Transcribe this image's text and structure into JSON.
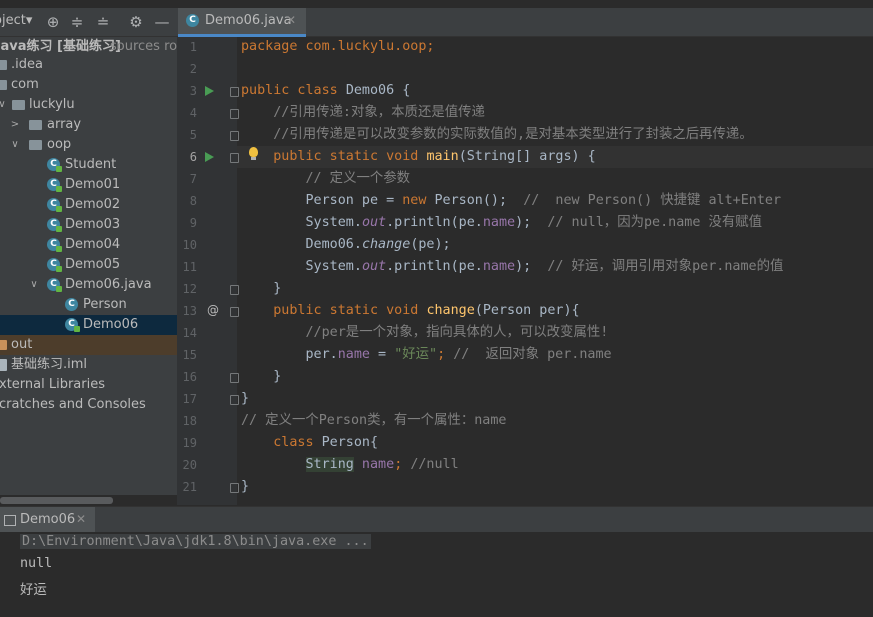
{
  "project_panel": {
    "title": "oject",
    "tree": [
      {
        "label": "java练习 [基础练习]",
        "secondary": "sources roc"
      },
      {
        "label": ".idea"
      },
      {
        "label": "com"
      },
      {
        "label": "luckylu"
      },
      {
        "label": "array"
      },
      {
        "label": "oop"
      },
      {
        "label": "Student"
      },
      {
        "label": "Demo01"
      },
      {
        "label": "Demo02"
      },
      {
        "label": "Demo03"
      },
      {
        "label": "Demo04"
      },
      {
        "label": "Demo05"
      },
      {
        "label": "Demo06.java"
      },
      {
        "label": "Person"
      },
      {
        "label": "Demo06"
      },
      {
        "label": "out"
      },
      {
        "label": "基础练习.iml"
      },
      {
        "label": "xternal Libraries"
      },
      {
        "label": "cratches and Consoles"
      }
    ]
  },
  "editor": {
    "tab": {
      "label": "Demo06.java",
      "close": "✕"
    },
    "line_numbers": [
      "1",
      "2",
      "3",
      "4",
      "5",
      "6",
      "7",
      "8",
      "9",
      "10",
      "11",
      "12",
      "13",
      "14",
      "15",
      "16",
      "17",
      "18",
      "19",
      "20",
      "21"
    ],
    "code": {
      "l1": "package com.luckylu.oop;",
      "l3_kw": "public class ",
      "l3_name": "Demo06 {",
      "l4": "    //引用传递:对象，本质还是值传递",
      "l5": "    //引用传递是可以改变参数的实际数值的,是对基本类型进行了封装之后再传递。",
      "l6_kw": "    public static void ",
      "l6_fn": "main",
      "l6_rest": "(String[] args) {",
      "l7": "        // 定义一个参数",
      "l8_a": "        Person pe = ",
      "l8_kw": "new ",
      "l8_b": "Person();  ",
      "l8_c": "//  new Person() 快捷键 alt+Enter",
      "l9_a": "        System.",
      "l9_out": "out",
      "l9_b": ".println(pe.",
      "l9_name": "name",
      "l9_c": ");  ",
      "l9_cm": "// null，因为pe.name 没有赋值",
      "l10_a": "        Demo06.",
      "l10_m": "change",
      "l10_b": "(pe);",
      "l11_a": "        System.",
      "l11_out": "out",
      "l11_b": ".println(pe.",
      "l11_name": "name",
      "l11_c": ");  ",
      "l11_cm": "// 好运，调用引用对象per.name的值",
      "l12": "    }",
      "l13_kw": "    public static void ",
      "l13_fn": "change",
      "l13_rest": "(Person per){",
      "l14": "        //per是一个对象，指向具体的人，可以改变属性!",
      "l15_a": "        per.",
      "l15_name": "name",
      "l15_b": " = ",
      "l15_str": "\"好运\"",
      "l15_c": "; ",
      "l15_cm": "//  返回对象 per.name",
      "l16": "    }",
      "l17": "}",
      "l18": "// 定义一个Person类，有一个属性：name",
      "l19_kw": "    class ",
      "l19_rest": "Person{",
      "l20_type": "String",
      "l20_name": " name",
      "l20_c": "; ",
      "l20_cm": "//null",
      "l21": "}"
    }
  },
  "run_panel": {
    "tab": {
      "label": "Demo06",
      "close": "✕"
    },
    "command": "D:\\Environment\\Java\\jdk1.8\\bin\\java.exe ...",
    "output": [
      "null",
      "好运"
    ]
  },
  "colors": {
    "keyword": "#cc7832",
    "comment": "#808080",
    "method": "#ffc66d",
    "field": "#9876aa",
    "string": "#6a8759",
    "text": "#a9b7c6",
    "selection": "#0d293e"
  }
}
